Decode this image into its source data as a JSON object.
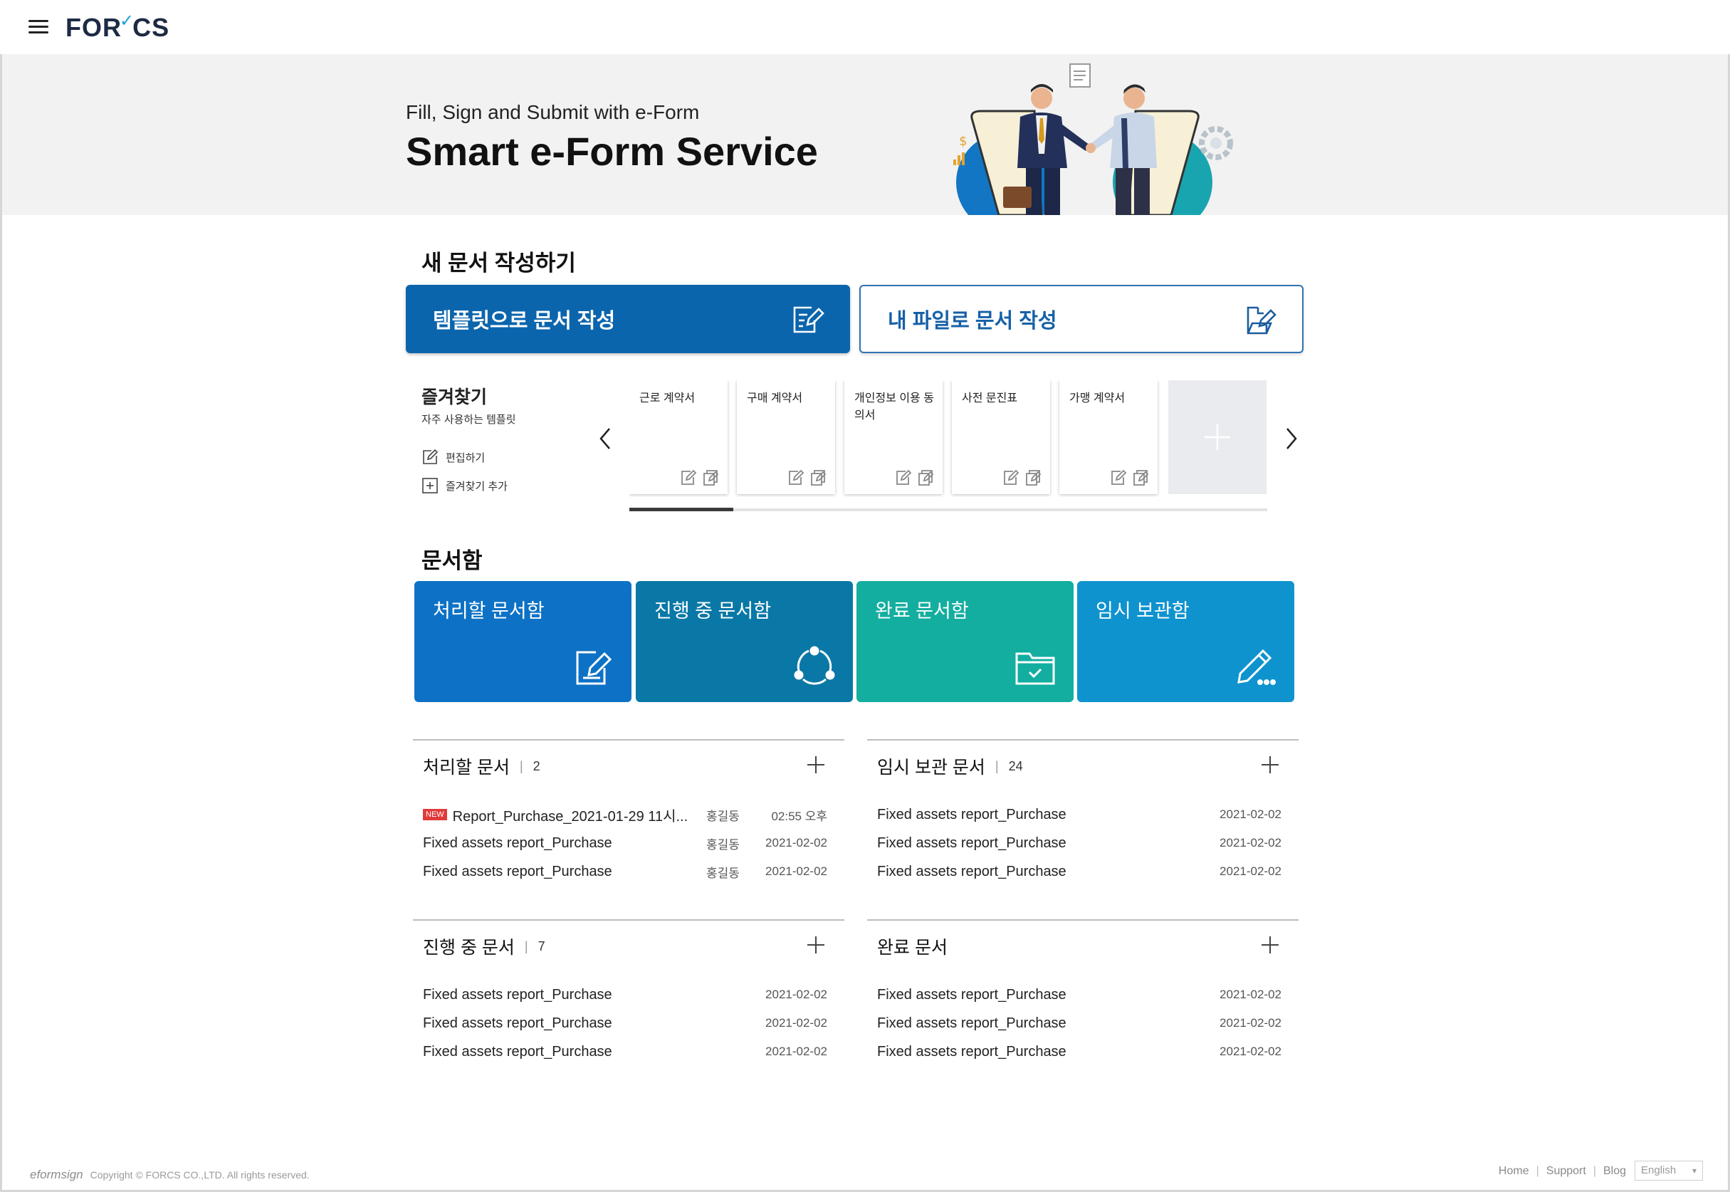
{
  "header": {
    "logo_text_a": "FOR",
    "logo_text_b": "CS"
  },
  "hero": {
    "subtitle": "Fill, Sign and Submit with e-Form",
    "title": "Smart e-Form Service"
  },
  "create": {
    "title": "새 문서 작성하기",
    "template_label": "템플릿으로 문서 작성",
    "file_label": "내 파일로 문서 작성"
  },
  "favorites": {
    "title": "즐겨찾기",
    "subtitle": "자주 사용하는 템플릿",
    "edit_label": "편집하기",
    "add_label": "즐겨찾기 추가",
    "cards": [
      "근로 계약서",
      "구매 계약서",
      "개인정보 이용 동의서",
      "사전 문진표",
      "가맹 계약서"
    ]
  },
  "boxes": {
    "title": "문서함",
    "tiles": [
      {
        "label": "처리할 문서함",
        "color": "#0d72c5"
      },
      {
        "label": "진행 중 문서함",
        "color": "#0a78a6"
      },
      {
        "label": "완료 문서함",
        "color": "#13aea0"
      },
      {
        "label": "임시 보관함",
        "color": "#0e93cf"
      }
    ]
  },
  "lists": {
    "todo": {
      "title": "처리할 문서",
      "count": "2",
      "rows": [
        {
          "badge": "NEW",
          "title": "Report_Purchase_2021-01-29 11시...",
          "user": "홍길동",
          "date": "02:55 오후"
        },
        {
          "title": "Fixed assets report_Purchase",
          "user": "홍길동",
          "date": "2021-02-02"
        },
        {
          "title": "Fixed assets report_Purchase",
          "user": "홍길동",
          "date": "2021-02-02"
        }
      ]
    },
    "draft": {
      "title": "임시 보관 문서",
      "count": "24",
      "rows": [
        {
          "title": "Fixed assets report_Purchase",
          "date": "2021-02-02"
        },
        {
          "title": "Fixed assets report_Purchase",
          "date": "2021-02-02"
        },
        {
          "title": "Fixed assets report_Purchase",
          "date": "2021-02-02"
        }
      ]
    },
    "progress": {
      "title": "진행 중 문서",
      "count": "7",
      "rows": [
        {
          "title": "Fixed assets report_Purchase",
          "date": "2021-02-02"
        },
        {
          "title": "Fixed assets report_Purchase",
          "date": "2021-02-02"
        },
        {
          "title": "Fixed assets report_Purchase",
          "date": "2021-02-02"
        }
      ]
    },
    "done": {
      "title": "완료 문서",
      "rows": [
        {
          "title": "Fixed assets report_Purchase",
          "date": "2021-02-02"
        },
        {
          "title": "Fixed assets report_Purchase",
          "date": "2021-02-02"
        },
        {
          "title": "Fixed assets report_Purchase",
          "date": "2021-02-02"
        }
      ]
    }
  },
  "footer": {
    "brand": "eformsign",
    "copyright": "Copyright © FORCS CO.,LTD. All rights reserved.",
    "links": [
      "Home",
      "Support",
      "Blog"
    ],
    "language": "English"
  }
}
